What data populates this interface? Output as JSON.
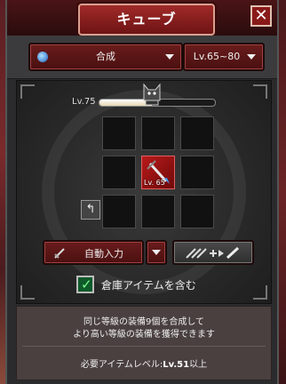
{
  "window": {
    "title": "キューブ",
    "close_label": "✕"
  },
  "dropdowns": {
    "category": "合成",
    "level_range": "Lv.65~80"
  },
  "level_bar": {
    "label": "Lv.75",
    "progress": 0.45
  },
  "grid": {
    "rows": 3,
    "cols": 3,
    "filled_item_level": "Lv. 65"
  },
  "buttons": {
    "auto_input": "自動入力",
    "back_icon": "back-arrow-icon"
  },
  "checkbox": {
    "label": "倉庫アイテムを含む",
    "checked": true
  },
  "info": {
    "line1": "同じ等級の装備9個を合成して",
    "line2": "より高い等級の装備を獲得できます",
    "req_prefix": "必要アイテムレベル:",
    "req_value": "Lv.51",
    "req_suffix": "以上"
  },
  "colors": {
    "accent_red": "#a02a28",
    "check_green": "#0e5a2a"
  }
}
